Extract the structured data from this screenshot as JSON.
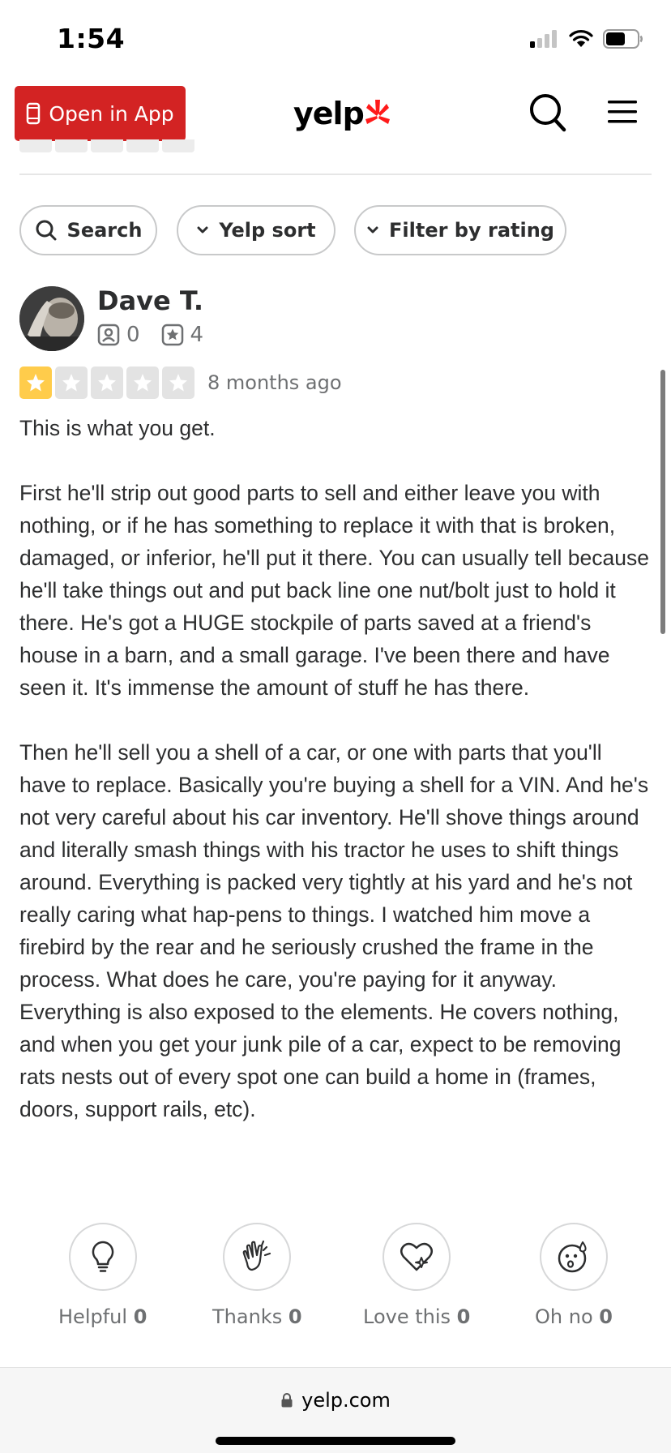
{
  "status_bar": {
    "time": "1:54",
    "icons": [
      "signal-icon",
      "wifi-icon",
      "battery-icon"
    ]
  },
  "header": {
    "open_app_label": "Open in App",
    "logo_text": "yelp",
    "brand_color": "#d32323"
  },
  "filters": {
    "search_label": "Search",
    "sort_label": "Yelp sort",
    "rating_filter_label": "Filter by rating"
  },
  "review": {
    "reviewer_name": "Dave T.",
    "friends_count": "0",
    "reviews_count": "4",
    "rating": 1,
    "max_rating": 5,
    "date": "8 months ago",
    "paragraphs": [
      "This is what you get.",
      "First he'll strip out good parts to sell and either leave you with nothing, or if he has something to replace it with that is broken, damaged, or inferior, he'll put it there. You can usually tell because he'll take things out and put back line one nut/bolt just to hold it there. He's got a HUGE stockpile of parts saved at a friend's house in a barn, and a small garage. I've been there and have seen it. It's immense the amount of stuff he has there.",
      "Then he'll sell you a shell of a car, or one with parts that you'll have to replace. Basically you're buying a shell for a VIN. And he's not very careful about his car inventory. He'll shove things around and literally smash things with his tractor he uses to shift things around. Everything is packed very tightly at his yard and he's not really caring what hap-pens to things. I watched him move a firebird by the rear and he seriously crushed the frame in the process. What does he care, you're paying for it anyway. Everything is also exposed to the elements. He covers nothing, and when you get your junk pile of a car, expect to be removing rats nests out of every spot one can build a home in (frames, doors, support rails, etc)."
    ]
  },
  "reactions": [
    {
      "label": "Helpful",
      "count": "0",
      "icon": "lightbulb-icon"
    },
    {
      "label": "Thanks",
      "count": "0",
      "icon": "clapping-hands-icon"
    },
    {
      "label": "Love this",
      "count": "0",
      "icon": "heart-icon"
    },
    {
      "label": "Oh no",
      "count": "0",
      "icon": "oh-no-face-icon"
    }
  ],
  "browser": {
    "url": "yelp.com"
  },
  "colors": {
    "star_on": "#ffcc4b",
    "star_off": "#e3e3e3",
    "text": "#2d2e2f",
    "muted": "#6e7072"
  }
}
